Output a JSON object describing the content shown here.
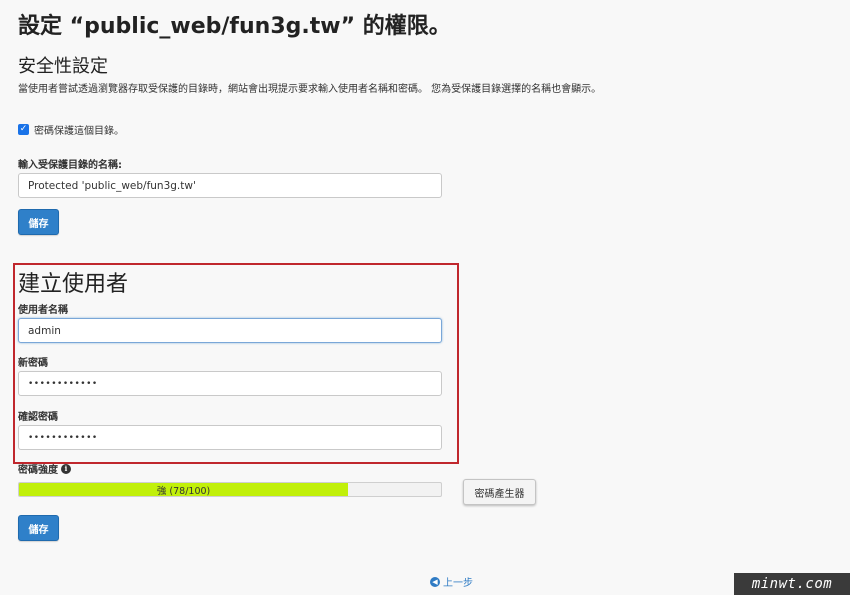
{
  "header": {
    "title": "設定 “public_web/fun3g.tw” 的權限。"
  },
  "security": {
    "heading": "安全性設定",
    "description": "當使用者嘗試透過瀏覽器存取受保護的目錄時，網站會出現提示要求輸入使用者名稱和密碼。 您為受保護目錄選擇的名稱也會顯示。",
    "protect_checkbox_label": "密碼保護這個目錄。",
    "protect_checked": true,
    "dir_name_label": "輸入受保護目錄的名稱:",
    "dir_name_value": "Protected 'public_web/fun3g.tw'",
    "save_label": "儲存"
  },
  "create_user": {
    "heading": "建立使用者",
    "username_label": "使用者名稱",
    "username_value": "admin",
    "new_password_label": "新密碼",
    "new_password_value": "••••••••••••",
    "confirm_password_label": "確認密碼",
    "confirm_password_value": "••••••••••••",
    "strength_label": "密碼強度",
    "strength_text": "強 (78/100)",
    "strength_percent": 78,
    "strength_color": "#c1f00a",
    "generator_label": "密碼產生器",
    "save_label": "儲存"
  },
  "footer": {
    "back_label": "上一步"
  },
  "watermark": "minwt.com",
  "colors": {
    "primary_button": "#2f80c9",
    "highlight_box": "#c0272d",
    "link": "#2f7bc4"
  }
}
